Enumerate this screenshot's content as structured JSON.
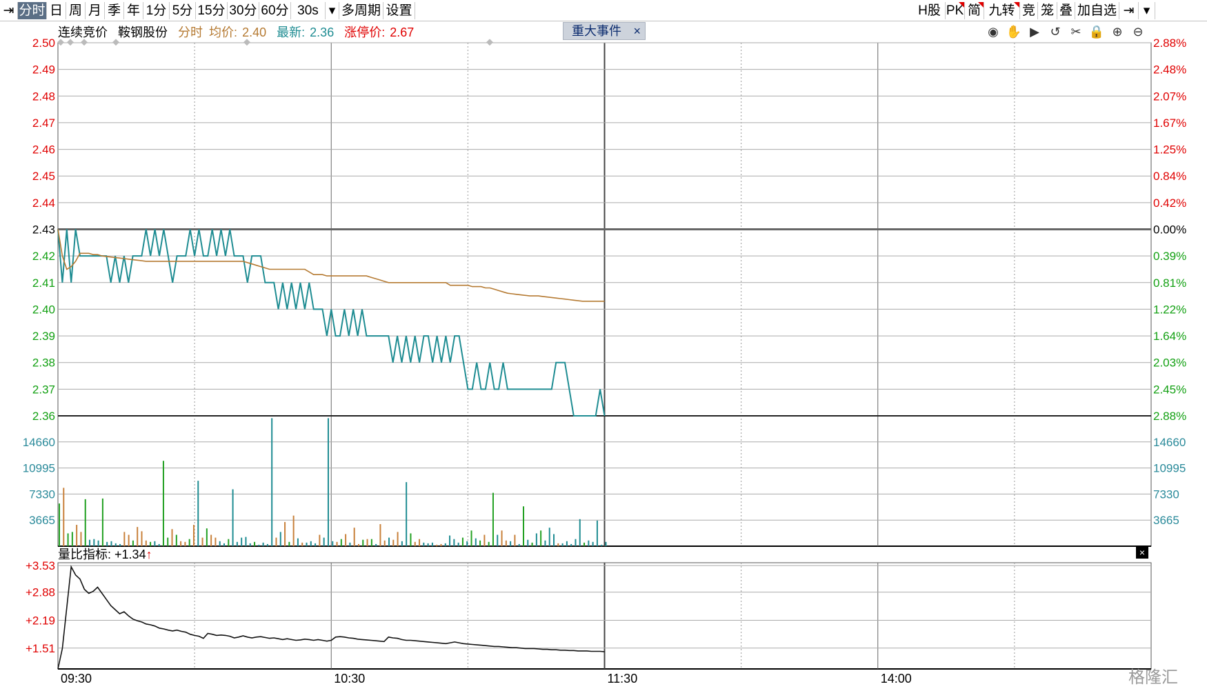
{
  "toolbar": {
    "left": [
      {
        "key": "pin",
        "label": "⇥"
      },
      {
        "key": "fenshi",
        "label": "分时",
        "active": true
      },
      {
        "key": "ri",
        "label": "日"
      },
      {
        "key": "zhou",
        "label": "周"
      },
      {
        "key": "yue",
        "label": "月"
      },
      {
        "key": "ji",
        "label": "季"
      },
      {
        "key": "nian",
        "label": "年"
      },
      {
        "key": "m1",
        "label": "1分"
      },
      {
        "key": "m5",
        "label": "5分"
      },
      {
        "key": "m15",
        "label": "15分"
      },
      {
        "key": "m30",
        "label": "30分"
      },
      {
        "key": "m60",
        "label": "60分"
      },
      {
        "key": "s30",
        "label": "30s"
      },
      {
        "key": "dropdown",
        "label": "▾"
      },
      {
        "key": "duozhouqi",
        "label": "多周期"
      },
      {
        "key": "shezhi",
        "label": "设置"
      }
    ],
    "right": [
      {
        "key": "hgu",
        "label": "H股"
      },
      {
        "key": "pk",
        "label": "PK",
        "flag": true
      },
      {
        "key": "jian",
        "label": "简",
        "flag": true
      },
      {
        "key": "jiuzhuan",
        "label": "九转",
        "flag": true
      },
      {
        "key": "jing",
        "label": "竞"
      },
      {
        "key": "long",
        "label": "笼"
      },
      {
        "key": "die",
        "label": "叠"
      },
      {
        "key": "jiazixuan",
        "label": "加自选"
      },
      {
        "key": "pin2",
        "label": "⇥"
      },
      {
        "key": "more",
        "label": "▾"
      }
    ]
  },
  "info": {
    "mode": "连续竞价",
    "name": "鞍钢股份",
    "period": "分时",
    "avg_label": "均价:",
    "avg_value": "2.40",
    "latest_label": "最新:",
    "latest_value": "2.36",
    "limit_label": "涨停价:",
    "limit_value": "2.67"
  },
  "event": {
    "label": "重大事件",
    "close": "×"
  },
  "tools": [
    "eye-icon",
    "hand-icon",
    "play-icon",
    "undo-icon",
    "scissors-icon",
    "lock-icon",
    "zoom-in-icon",
    "zoom-out-icon"
  ],
  "indicator": {
    "label": "量比指标:",
    "value": "+1.34",
    "arrow": "↑"
  },
  "watermark": "格隆汇",
  "colors": {
    "up": "#e00000",
    "down": "#12a012",
    "price_line": "#1e8c92",
    "avg_line": "#b57a32",
    "vol_teal": "#1e8c92",
    "vol_orange": "#c8803a",
    "vol_green": "#22a022",
    "grid": "#808080",
    "volume_axis": "#2a8a9a"
  },
  "chart_data": [
    {
      "type": "line",
      "name": "price",
      "y_ticks": [
        "2.50",
        "2.49",
        "2.48",
        "2.47",
        "2.46",
        "2.45",
        "2.44",
        "2.43",
        "2.42",
        "2.41",
        "2.40",
        "2.39",
        "2.38",
        "2.37",
        "2.36"
      ],
      "y_ticks_right": [
        "2.88%",
        "2.48%",
        "2.07%",
        "1.67%",
        "1.25%",
        "0.84%",
        "0.42%",
        "0.00%",
        "0.39%",
        "0.81%",
        "1.22%",
        "1.64%",
        "2.03%",
        "2.45%",
        "2.88%"
      ],
      "ylim": [
        2.36,
        2.5
      ],
      "prev_close": 2.43,
      "x_ticks": [
        "09:30",
        "10:30",
        "11:30",
        "14:00"
      ],
      "price": [
        2.43,
        2.41,
        2.43,
        2.41,
        2.43,
        2.42,
        2.42,
        2.42,
        2.42,
        2.42,
        2.42,
        2.42,
        2.41,
        2.42,
        2.41,
        2.42,
        2.41,
        2.42,
        2.42,
        2.42,
        2.43,
        2.42,
        2.43,
        2.42,
        2.43,
        2.42,
        2.41,
        2.42,
        2.42,
        2.42,
        2.43,
        2.42,
        2.43,
        2.42,
        2.42,
        2.43,
        2.42,
        2.43,
        2.42,
        2.43,
        2.42,
        2.42,
        2.42,
        2.41,
        2.42,
        2.42,
        2.42,
        2.41,
        2.41,
        2.41,
        2.4,
        2.41,
        2.4,
        2.41,
        2.4,
        2.41,
        2.4,
        2.41,
        2.4,
        2.4,
        2.4,
        2.39,
        2.4,
        2.39,
        2.39,
        2.4,
        2.39,
        2.4,
        2.39,
        2.4,
        2.39,
        2.39,
        2.39,
        2.39,
        2.39,
        2.39,
        2.38,
        2.39,
        2.38,
        2.39,
        2.38,
        2.39,
        2.38,
        2.39,
        2.39,
        2.38,
        2.39,
        2.38,
        2.39,
        2.38,
        2.39,
        2.39,
        2.38,
        2.37,
        2.37,
        2.38,
        2.37,
        2.37,
        2.38,
        2.37,
        2.37,
        2.38,
        2.37,
        2.37,
        2.37,
        2.37,
        2.37,
        2.37,
        2.37,
        2.37,
        2.37,
        2.37,
        2.37,
        2.38,
        2.38,
        2.38,
        2.37,
        2.36,
        2.36,
        2.36,
        2.36,
        2.36,
        2.36,
        2.37,
        2.36
      ],
      "avg": [
        2.43,
        2.42,
        2.415,
        2.416,
        2.418,
        2.421,
        2.421,
        2.421,
        2.4205,
        2.4205,
        2.42,
        2.4198,
        2.4196,
        2.4194,
        2.4192,
        2.419,
        2.4188,
        2.4186,
        2.4184,
        2.4182,
        2.418,
        2.418,
        2.418,
        2.418,
        2.418,
        2.418,
        2.418,
        2.418,
        2.418,
        2.418,
        2.418,
        2.418,
        2.418,
        2.418,
        2.418,
        2.418,
        2.418,
        2.418,
        2.418,
        2.418,
        2.418,
        2.418,
        2.418,
        2.4175,
        2.417,
        2.4165,
        2.416,
        2.4155,
        2.415,
        2.415,
        2.415,
        2.415,
        2.415,
        2.415,
        2.415,
        2.415,
        2.415,
        2.414,
        2.413,
        2.413,
        2.413,
        2.4125,
        2.4125,
        2.4125,
        2.4125,
        2.4125,
        2.4125,
        2.4125,
        2.4125,
        2.4125,
        2.4125,
        2.412,
        2.4115,
        2.411,
        2.4105,
        2.41,
        2.41,
        2.41,
        2.41,
        2.41,
        2.41,
        2.41,
        2.41,
        2.41,
        2.41,
        2.41,
        2.41,
        2.41,
        2.41,
        2.409,
        2.409,
        2.409,
        2.409,
        2.409,
        2.4085,
        2.4085,
        2.4085,
        2.408,
        2.408,
        2.4075,
        2.407,
        2.4065,
        2.406,
        2.4058,
        2.4056,
        2.4054,
        2.4052,
        2.405,
        2.405,
        2.405,
        2.4048,
        2.4046,
        2.4044,
        2.4042,
        2.404,
        2.4038,
        2.4036,
        2.4034,
        2.4032,
        2.403,
        2.403,
        2.403,
        2.403,
        2.403,
        2.403
      ]
    },
    {
      "type": "bar",
      "name": "volume",
      "y_ticks": [
        "14660",
        "10995",
        "7330",
        "3665"
      ],
      "ylim": [
        0,
        18325
      ],
      "volumes": [
        6000,
        8200,
        1800,
        2000,
        3000,
        2000,
        6600,
        900,
        1000,
        800,
        6700,
        600,
        700,
        400,
        300,
        2000,
        1600,
        800,
        2700,
        2100,
        800,
        600,
        700,
        300,
        12000,
        1200,
        2400,
        1600,
        700,
        600,
        1000,
        3000,
        9200,
        1200,
        2500,
        1600,
        1200,
        700,
        400,
        1000,
        8000,
        600,
        1200,
        1300,
        400,
        600,
        200,
        500,
        300,
        18000,
        1200,
        2000,
        3400,
        600,
        4300,
        1100,
        500,
        500,
        700,
        400,
        1600,
        1200,
        18000,
        700,
        600,
        1000,
        1700,
        500,
        2600,
        300,
        900,
        1000,
        1000,
        300,
        3100,
        800,
        1200,
        900,
        2000,
        700,
        9000,
        1800,
        600,
        1000,
        500,
        400,
        500,
        200,
        300,
        400,
        1500,
        1000,
        500,
        1200,
        700,
        2200,
        1100,
        800,
        1600,
        600,
        7500,
        1600,
        2200,
        800,
        700,
        1600,
        300,
        5600,
        900,
        500,
        1800,
        2200,
        800,
        2600,
        1700,
        400,
        400,
        700,
        300,
        1000,
        3800,
        500,
        800,
        600,
        3600,
        200,
        600
      ],
      "vol_colors": [
        "g",
        "o",
        "g",
        "g",
        "o",
        "o",
        "g",
        "t",
        "t",
        "t",
        "g",
        "t",
        "t",
        "t",
        "t",
        "o",
        "o",
        "g",
        "o",
        "o",
        "o",
        "g",
        "t",
        "t",
        "g",
        "g",
        "o",
        "g",
        "o",
        "o",
        "g",
        "o",
        "t",
        "o",
        "g",
        "o",
        "o",
        "t",
        "t",
        "g",
        "t",
        "t",
        "t",
        "t",
        "t",
        "g",
        "t",
        "t",
        "t",
        "t",
        "o",
        "t",
        "o",
        "g",
        "o",
        "t",
        "o",
        "t",
        "t",
        "t",
        "o",
        "t",
        "t",
        "t",
        "o",
        "g",
        "o",
        "t",
        "o",
        "o",
        "g",
        "o",
        "g",
        "t",
        "o",
        "o",
        "t",
        "o",
        "o",
        "t",
        "t",
        "g",
        "o",
        "o",
        "t",
        "t",
        "t",
        "o",
        "o",
        "t",
        "t",
        "t",
        "t",
        "g",
        "t",
        "g",
        "t",
        "g",
        "o",
        "g",
        "g",
        "t",
        "o",
        "o",
        "t",
        "o",
        "t",
        "g",
        "t",
        "g",
        "t",
        "g",
        "t",
        "t",
        "t",
        "o",
        "t",
        "t",
        "t",
        "t",
        "t",
        "g",
        "t",
        "t",
        "t"
      ]
    },
    {
      "type": "line",
      "name": "volume_ratio",
      "y_ticks": [
        "+3.53",
        "+2.88",
        "+2.19",
        "+1.51"
      ],
      "ylim": [
        1.0,
        3.6
      ],
      "values": [
        1.0,
        1.5,
        2.5,
        3.5,
        3.3,
        3.2,
        2.95,
        2.85,
        2.9,
        3.0,
        2.85,
        2.7,
        2.55,
        2.45,
        2.35,
        2.4,
        2.3,
        2.22,
        2.18,
        2.15,
        2.1,
        2.08,
        2.05,
        2.0,
        1.98,
        1.95,
        1.93,
        1.95,
        1.92,
        1.9,
        1.85,
        1.82,
        1.8,
        1.75,
        1.87,
        1.85,
        1.82,
        1.83,
        1.82,
        1.8,
        1.76,
        1.78,
        1.81,
        1.78,
        1.76,
        1.78,
        1.79,
        1.77,
        1.75,
        1.76,
        1.74,
        1.72,
        1.74,
        1.72,
        1.7,
        1.71,
        1.73,
        1.72,
        1.7,
        1.72,
        1.7,
        1.68,
        1.7,
        1.78,
        1.79,
        1.78,
        1.76,
        1.75,
        1.73,
        1.72,
        1.71,
        1.7,
        1.69,
        1.68,
        1.67,
        1.78,
        1.76,
        1.75,
        1.72,
        1.7,
        1.7,
        1.69,
        1.68,
        1.67,
        1.66,
        1.65,
        1.64,
        1.63,
        1.62,
        1.64,
        1.66,
        1.64,
        1.62,
        1.61,
        1.6,
        1.59,
        1.58,
        1.57,
        1.56,
        1.55,
        1.55,
        1.54,
        1.53,
        1.52,
        1.52,
        1.51,
        1.5,
        1.5,
        1.5,
        1.49,
        1.48,
        1.48,
        1.47,
        1.47,
        1.46,
        1.46,
        1.45,
        1.45,
        1.44,
        1.44,
        1.44,
        1.43,
        1.43,
        1.43,
        1.42
      ]
    }
  ]
}
